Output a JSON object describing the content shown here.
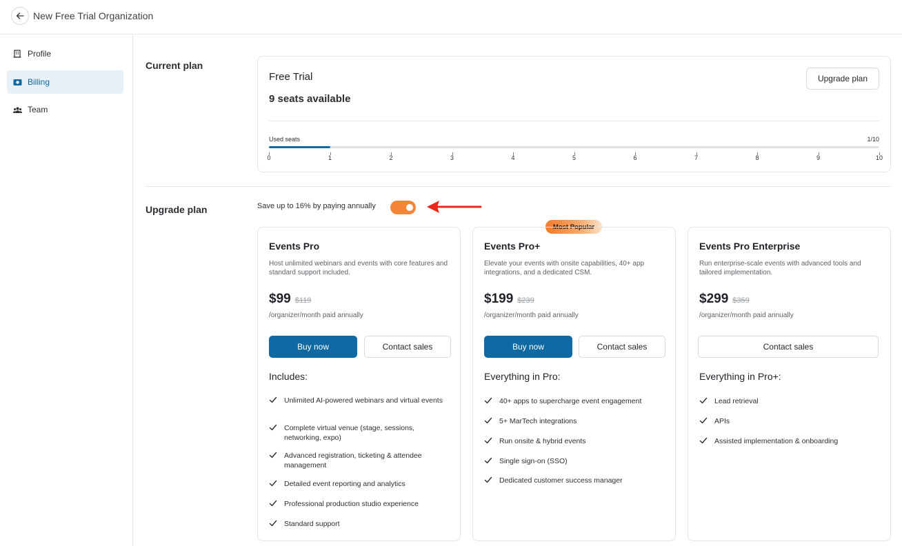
{
  "header": {
    "title": "New Free Trial Organization"
  },
  "sidebar": {
    "items": [
      {
        "label": "Profile",
        "icon": "building-icon",
        "active": false
      },
      {
        "label": "Billing",
        "icon": "billing-icon",
        "active": true
      },
      {
        "label": "Team",
        "icon": "team-icon",
        "active": false
      }
    ]
  },
  "current_plan": {
    "section_title": "Current plan",
    "plan_name": "Free Trial",
    "seats_available": "9 seats available",
    "upgrade_button": "Upgrade plan",
    "used_seats_label": "Used seats",
    "used_count": "1/10",
    "used_seats": 1,
    "total_seats": 10,
    "ticks": [
      "0",
      "1",
      "2",
      "3",
      "4",
      "5",
      "6",
      "7",
      "8",
      "9",
      "10"
    ]
  },
  "upgrade": {
    "section_title": "Upgrade plan",
    "annual_toggle_label": "Save up to 16% by paying annually",
    "annual_toggle_on": true,
    "popular_badge": "Most Popular",
    "plans": [
      {
        "name": "Events Pro",
        "description": "Host unlimited webinars and events with core features and standard support included.",
        "price": "$99",
        "old_price": "$119",
        "period": "/organizer/month paid annually",
        "buy_label": "Buy now",
        "contact_label": "Contact sales",
        "includes_title": "Includes:",
        "features": [
          "Unlimited AI-powered webinars and virtual events",
          "Complete virtual venue (stage, sessions, networking, expo)",
          "Advanced registration, ticketing & attendee management",
          "Detailed event reporting and analytics",
          "Professional production studio experience",
          "Standard support"
        ]
      },
      {
        "name": "Events Pro+",
        "description": "Elevate your events with onsite capabilities, 40+ app integrations, and a dedicated CSM.",
        "price": "$199",
        "old_price": "$239",
        "period": "/organizer/month paid annually",
        "buy_label": "Buy now",
        "contact_label": "Contact sales",
        "includes_title": "Everything in Pro:",
        "features": [
          "40+ apps to supercharge event engagement",
          "5+ MarTech integrations",
          "Run onsite & hybrid events",
          "Single sign-on (SSO)",
          "Dedicated customer success manager"
        ]
      },
      {
        "name": "Events Pro Enterprise",
        "description": "Run enterprise-scale events with advanced tools and tailored implementation.",
        "price": "$299",
        "old_price": "$359",
        "period": "/organizer/month paid annually",
        "contact_label": "Contact sales",
        "includes_title": "Everything in Pro+:",
        "features": [
          "Lead retrieval",
          "APIs",
          "Assisted implementation & onboarding"
        ]
      }
    ]
  },
  "colors": {
    "primary": "#0f6aa4",
    "toggle": "#f4863a",
    "annotation_arrow": "#e8281c"
  }
}
